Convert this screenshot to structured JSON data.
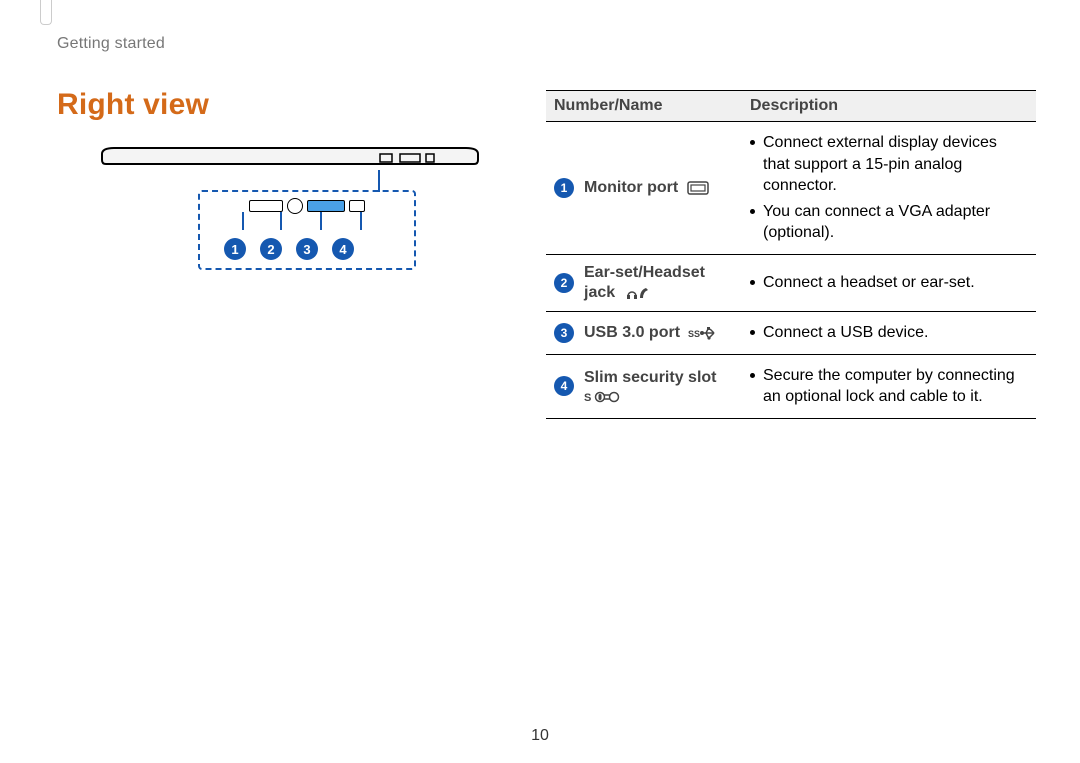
{
  "section_label": "Getting started",
  "heading": "Right view",
  "callouts": [
    "1",
    "2",
    "3",
    "4"
  ],
  "table": {
    "headers": {
      "name": "Number/Name",
      "desc": "Description"
    },
    "rows": [
      {
        "num": "1",
        "name": "Monitor port",
        "icon": "monitor-port-icon",
        "bullets": [
          "Connect external display devices that support a 15-pin analog connector.",
          "You can connect a VGA adapter (optional)."
        ]
      },
      {
        "num": "2",
        "name": "Ear-set/Headset jack",
        "icon": "headset-jack-icon",
        "bullets": [
          "Connect a headset or ear-set."
        ]
      },
      {
        "num": "3",
        "name": "USB 3.0 port",
        "icon": "usb-ss-icon",
        "bullets": [
          "Connect a USB device."
        ]
      },
      {
        "num": "4",
        "name": "Slim security slot",
        "icon": "security-slot-icon",
        "bullets": [
          "Secure the computer by connecting an optional lock and cable to it."
        ]
      }
    ]
  },
  "page_number": "10"
}
